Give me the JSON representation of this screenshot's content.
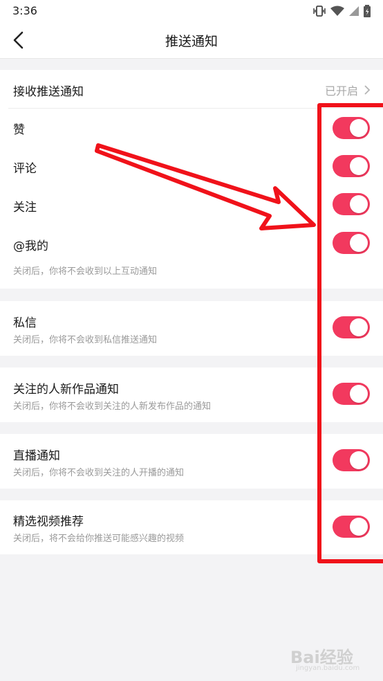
{
  "status_bar": {
    "time": "3:36"
  },
  "nav": {
    "title": "推送通知"
  },
  "receive": {
    "label": "接收推送通知",
    "status": "已开启"
  },
  "interaction": {
    "items": [
      {
        "label": "赞",
        "enabled": true
      },
      {
        "label": "评论",
        "enabled": true
      },
      {
        "label": "关注",
        "enabled": true
      },
      {
        "label": "@我的",
        "enabled": true
      }
    ],
    "hint": "关闭后，你将不会收到以上互动通知"
  },
  "settings": [
    {
      "label": "私信",
      "sub": "关闭后，你将不会收到私信推送通知",
      "enabled": true
    },
    {
      "label": "关注的人新作品通知",
      "sub": "关闭后，你将不会收到关注的人新发布作品的通知",
      "enabled": true
    },
    {
      "label": "直播通知",
      "sub": "关闭后，你将不会收到关注的人开播的通知",
      "enabled": true
    },
    {
      "label": "精选视频推荐",
      "sub": "关闭后，将不会给你推送可能感兴趣的视频",
      "enabled": true
    }
  ],
  "watermark": {
    "brand": "Bai经验",
    "url": "jingyan.baidu.com"
  },
  "colors": {
    "toggle_on": "#f2395e",
    "annotation": "#f0121a",
    "page_bg": "#f3f3f5"
  }
}
